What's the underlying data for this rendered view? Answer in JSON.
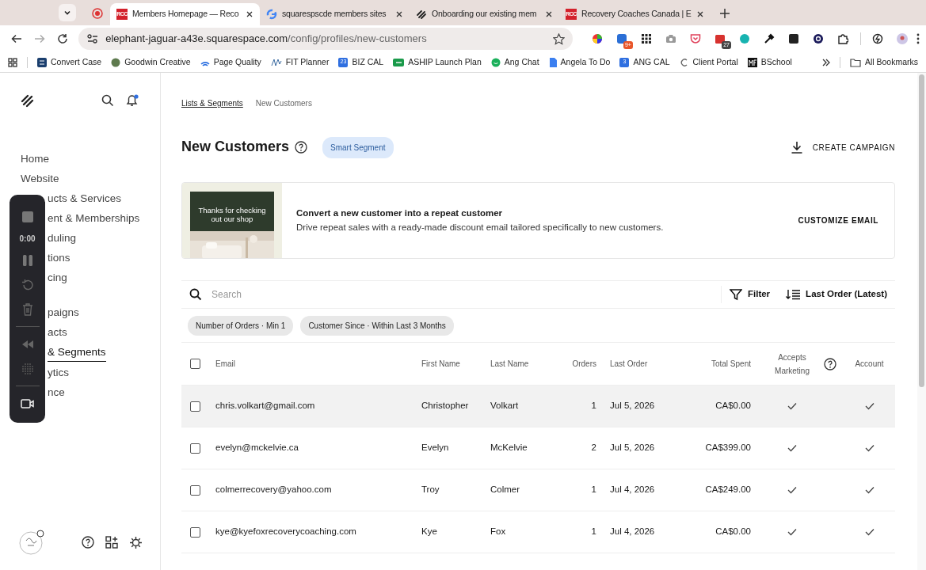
{
  "browser": {
    "tabs": [
      {
        "title": "Members Homepage — Reco",
        "favicon_text": "RCC",
        "selected": true
      },
      {
        "title": "squarespscde members sites",
        "selected": false
      },
      {
        "title": "Onboarding our existing mem",
        "selected": false
      },
      {
        "title": "Recovery Coaches Canada | E",
        "favicon_text": "RCC",
        "selected": false
      }
    ],
    "url_host": "elephant-jaguar-a43e.squarespace.com",
    "url_path": "/config/profiles/new-customers",
    "extensions": [
      {
        "kind": "color-wheel"
      },
      {
        "kind": "app",
        "badge": "9+"
      },
      {
        "kind": "grid"
      },
      {
        "kind": "camera"
      },
      {
        "kind": "pocket"
      },
      {
        "kind": "calendar",
        "badge": "27"
      },
      {
        "kind": "circle"
      },
      {
        "kind": "eyedropper"
      },
      {
        "kind": "square"
      },
      {
        "kind": "dark-circle"
      },
      {
        "kind": "puzzle"
      },
      {
        "kind": "leaf"
      },
      {
        "kind": "avatar"
      }
    ],
    "bookmarks": [
      {
        "label": "Convert Case"
      },
      {
        "label": "Goodwin Creative"
      },
      {
        "label": "Page Quality"
      },
      {
        "label": "FIT Planner"
      },
      {
        "label": "BIZ CAL",
        "icon_text": "23"
      },
      {
        "label": "ASHIP Launch Plan"
      },
      {
        "label": "Ang Chat"
      },
      {
        "label": "Angela To Do"
      },
      {
        "label": "ANG CAL",
        "icon_text": "3"
      },
      {
        "label": "Client Portal"
      },
      {
        "label": "BSchool"
      }
    ],
    "all_bookmarks": "All Bookmarks"
  },
  "sidebar": {
    "sections": [
      {
        "items": [
          {
            "label": "Home",
            "selected": false
          },
          {
            "label": "Website",
            "selected": false
          },
          {
            "label": "ucts & Services",
            "selected": false
          },
          {
            "label": "ent & Memberships",
            "selected": false
          },
          {
            "label": "duling",
            "selected": false
          },
          {
            "label": "tions",
            "selected": false
          },
          {
            "label": "cing",
            "selected": false
          }
        ]
      },
      {
        "items": [
          {
            "label": "paigns",
            "selected": false
          },
          {
            "label": "acts",
            "selected": false
          },
          {
            "label": "& Segments",
            "selected": true
          },
          {
            "label": "ytics",
            "selected": false
          },
          {
            "label": "nce",
            "selected": false
          }
        ]
      }
    ]
  },
  "recorder": {
    "time": "0:00"
  },
  "breadcrumb": [
    "Lists & Segments",
    "New Customers"
  ],
  "title": "New Customers",
  "badge": "Smart Segment",
  "create_campaign": "CREATE CAMPAIGN",
  "promo": {
    "image_text": "Thanks for checking out our shop",
    "title": "Convert a new customer into a repeat customer",
    "text": "Drive repeat sales with a ready-made discount email tailored specifically to new customers.",
    "action": "CUSTOMIZE EMAIL"
  },
  "search": {
    "placeholder": "Search"
  },
  "filter": "Filter",
  "sort": "Last Order (Latest)",
  "chips": [
    "Number of Orders · Min 1",
    "Customer Since · Within Last 3 Months"
  ],
  "table": {
    "all_selected": false,
    "columns": [
      "Email",
      "First Name",
      "Last Name",
      "Orders",
      "Last Order",
      "Total Spent",
      "Accepts Marketing",
      "Account"
    ],
    "rows": [
      {
        "email": "chris.volkart@gmail.com",
        "first": "Christopher",
        "last": "Volkart",
        "orders": "1",
        "last_order": "Jul 5, 2026",
        "total": "CA$0.00",
        "accepts_marketing": true,
        "account": true,
        "selected": false,
        "hovered": true
      },
      {
        "email": "evelyn@mckelvie.ca",
        "first": "Evelyn",
        "last": "McKelvie",
        "orders": "2",
        "last_order": "Jul 5, 2026",
        "total": "CA$399.00",
        "accepts_marketing": true,
        "account": true,
        "selected": false,
        "hovered": false
      },
      {
        "email": "colmerrecovery@yahoo.com",
        "first": "Troy",
        "last": "Colmer",
        "orders": "1",
        "last_order": "Jul 4, 2026",
        "total": "CA$249.00",
        "accepts_marketing": true,
        "account": true,
        "selected": false,
        "hovered": false
      },
      {
        "email": "kye@kyefoxrecoverycoaching.com",
        "first": "Kye",
        "last": "Fox",
        "orders": "1",
        "last_order": "Jul 4, 2026",
        "total": "CA$0.00",
        "accepts_marketing": true,
        "account": true,
        "selected": false,
        "hovered": false
      }
    ]
  }
}
